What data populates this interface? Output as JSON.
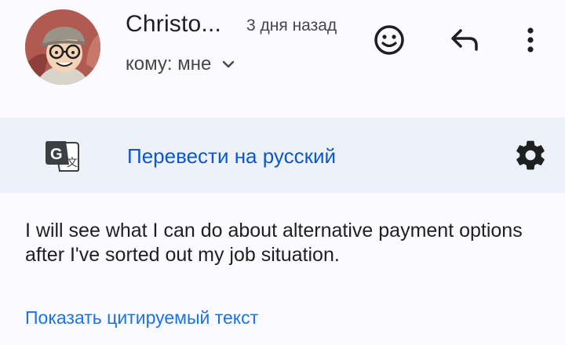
{
  "header": {
    "sender_name": "Christo...",
    "time": "3 дня назад",
    "recipient": "кому: мне",
    "avatar_icon": "avatar-cartoon-man-with-glasses-and-cap",
    "actions": {
      "emoji_icon": "add-reaction-smiley-icon",
      "reply_icon": "reply-arrow-icon",
      "more_icon": "more-vert-icon"
    }
  },
  "translate": {
    "icon": "google-translate-icon",
    "link": "Перевести на русский",
    "settings_icon": "gear-icon"
  },
  "message": {
    "body": "I will see what I can do about alternative payment options after I've sorted out my job situation.",
    "show_quoted": "Показать цитируемый текст"
  },
  "colors": {
    "background": "#fbfaff",
    "banner": "#edf1fa",
    "link": "#0b57d0",
    "quoted_link": "#1a73e8",
    "text": "#1f1f1f",
    "secondary_text": "#444746"
  }
}
